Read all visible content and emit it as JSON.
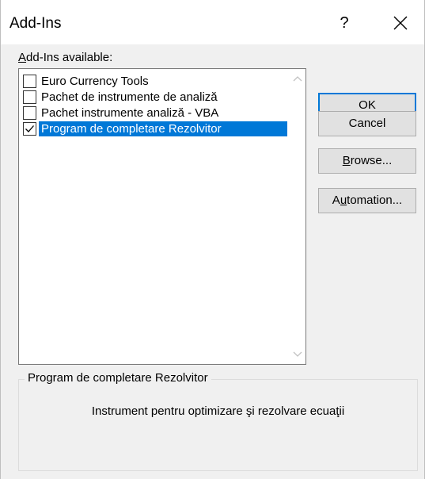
{
  "window": {
    "title": "Add-Ins",
    "help_glyph": "?",
    "close_icon": "close-icon"
  },
  "addins_list": {
    "label_mnemonic": "A",
    "label_rest": "dd-Ins available:",
    "items": [
      {
        "label": "Euro Currency Tools",
        "checked": false,
        "selected": false
      },
      {
        "label": "Pachet de instrumente de analiză",
        "checked": false,
        "selected": false
      },
      {
        "label": "Pachet instrumente analiză - VBA",
        "checked": false,
        "selected": false
      },
      {
        "label": "Program de completare Rezolvitor",
        "checked": true,
        "selected": true
      }
    ]
  },
  "buttons": {
    "ok": "OK",
    "cancel": "Cancel",
    "browse_mnemonic": "B",
    "browse_rest": "rowse...",
    "automation_pre": "A",
    "automation_mnemonic": "u",
    "automation_rest": "tomation..."
  },
  "details": {
    "title": "Program de completare Rezolvitor",
    "description": "Instrument pentru optimizare şi rezolvare ecuaţii"
  },
  "colors": {
    "selection": "#0078d7",
    "dialog_background": "#f0f0f0",
    "button_face": "#e1e1e1"
  }
}
